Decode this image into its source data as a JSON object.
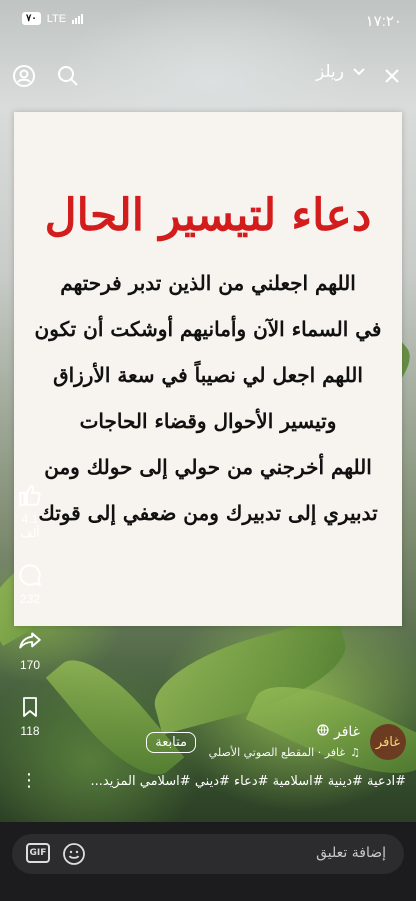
{
  "status_bar": {
    "time": "١٧:٢٠",
    "battery": "٧٠",
    "network": "LTE"
  },
  "header": {
    "title": "ريلز"
  },
  "post": {
    "title": "دعاء لتيسير الحال",
    "lines": [
      "اللهم اجعلني من الذين تدبر فرحتهم",
      "في السماء الآن وأمانيهم أوشكت أن تكون",
      "اللهم اجعل لي نصيباً في سعة الأرزاق",
      "وتيسير الأحوال وقضاء الحاجات",
      "اللهم أخرجني من حولي إلى حولك ومن",
      "تدبيري إلى تدبيرك ومن ضعفي إلى قوتك"
    ]
  },
  "actions": {
    "likes": "4.1 ألف",
    "comments": "232",
    "shares": "170",
    "saves": "118"
  },
  "author": {
    "name": "غافر",
    "avatar_text": "غافر",
    "audio": "غافر · المقطع الصوتي الأصلي",
    "follow_label": "متابعة"
  },
  "caption": {
    "tags": "#ادعية #دينية #اسلامية #دعاء #ديني #اسلامي المزيد..."
  },
  "comment_bar": {
    "placeholder": "إضافة تعليق",
    "gif_label": "GIF"
  },
  "colors": {
    "title_red": "#d31d1d",
    "bottom_bar": "#1c1c1e"
  }
}
